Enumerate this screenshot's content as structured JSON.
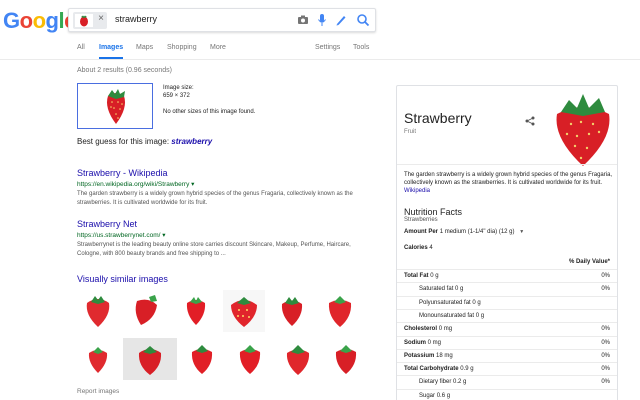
{
  "header": {
    "logo": [
      "G",
      "o",
      "o",
      "g",
      "l",
      "e"
    ],
    "query": "strawberry",
    "chip_close": "×"
  },
  "tabs": [
    {
      "label": "All",
      "active": false
    },
    {
      "label": "Images",
      "active": true
    },
    {
      "label": "Maps",
      "active": false
    },
    {
      "label": "Shopping",
      "active": false
    },
    {
      "label": "More",
      "active": false
    }
  ],
  "settings_label": "Settings",
  "tools_label": "Tools",
  "result_stats": "About 2 results (0.96 seconds)",
  "query_image": {
    "size_label": "Image size:",
    "size_value": "659 × 372",
    "other_sizes": "No other sizes of this image found."
  },
  "best_guess": {
    "prefix": "Best guess for this image:",
    "term": "strawberry"
  },
  "results": [
    {
      "title": "Strawberry - Wikipedia",
      "url": "https://en.wikipedia.org/wiki/Strawberry",
      "snippet": "The garden strawberry is a widely grown hybrid species of the genus Fragaria, collectively known as the strawberries. It is cultivated worldwide for its fruit."
    },
    {
      "title": "Strawberry Net",
      "url": "https://us.strawberrynet.com/",
      "snippet": "Strawberrynet is the leading beauty online store carries discount Skincare, Makeup, Perfume, Haircare, Cologne, with 800 beauty brands and free shipping to ..."
    }
  ],
  "similar_heading": "Visually similar images",
  "report_images": "Report images",
  "knowledge_panel": {
    "title": "Strawberry",
    "subtitle": "Fruit",
    "description": "The garden strawberry is a widely grown hybrid species of the genus Fragaria, collectively known as the strawberries. It is cultivated worldwide for its fruit.",
    "description_link": "Wikipedia",
    "nutrition_title": "Nutrition Facts",
    "nutrition_sub": "Strawberries",
    "amount_label": "Amount Per",
    "amount_value": "1 medium (1-1/4\" dia) (12 g)",
    "calories_label": "Calories",
    "calories_value": "4",
    "dv_header": "% Daily Value*",
    "rows": [
      {
        "label": "Total Fat",
        "value": "0 g",
        "pct": "0%",
        "bold": true,
        "indent": 0
      },
      {
        "label": "Saturated fat",
        "value": "0 g",
        "pct": "0%",
        "bold": false,
        "indent": 1
      },
      {
        "label": "Polyunsaturated fat",
        "value": "0 g",
        "pct": "",
        "bold": false,
        "indent": 1
      },
      {
        "label": "Monounsaturated fat",
        "value": "0 g",
        "pct": "",
        "bold": false,
        "indent": 1
      },
      {
        "label": "Cholesterol",
        "value": "0 mg",
        "pct": "0%",
        "bold": true,
        "indent": 0
      },
      {
        "label": "Sodium",
        "value": "0 mg",
        "pct": "0%",
        "bold": true,
        "indent": 0
      },
      {
        "label": "Potassium",
        "value": "18 mg",
        "pct": "0%",
        "bold": true,
        "indent": 0
      },
      {
        "label": "Total Carbohydrate",
        "value": "0.9 g",
        "pct": "0%",
        "bold": true,
        "indent": 0
      },
      {
        "label": "Dietary fiber",
        "value": "0.2 g",
        "pct": "0%",
        "bold": false,
        "indent": 1
      },
      {
        "label": "Sugar",
        "value": "0.6 g",
        "pct": "",
        "bold": false,
        "indent": 1
      }
    ]
  },
  "colors": {
    "link": "#1a0dab",
    "url": "#006621",
    "active_tab": "#1a73e8",
    "strawberry": "#d81f26",
    "leaf": "#2e8b3e"
  }
}
